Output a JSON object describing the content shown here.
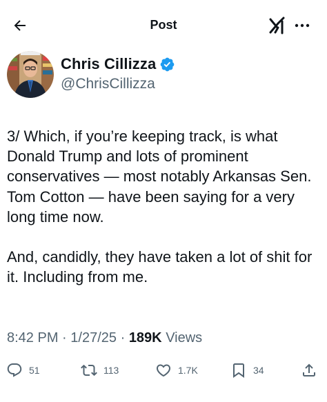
{
  "header": {
    "title": "Post",
    "back_icon": "arrow-left-icon",
    "grok_icon": "grok-icon",
    "more_icon": "more-horizontal-icon"
  },
  "author": {
    "name": "Chris Cillizza",
    "handle": "@ChrisCillizza",
    "verified": true,
    "verified_color": "#1d9bf0"
  },
  "tweet": {
    "paragraphs": [
      "3/ Which, if you’re keeping track, is what Donald Trump and lots of prominent conservatives — most notably Arkansas Sen. Tom Cotton — have been saying for a very long time now.",
      "And, candidly, they have taken a lot of shit for it. Including from me."
    ]
  },
  "meta": {
    "time": "8:42 PM",
    "separator": "·",
    "date": "1/27/25",
    "views_count": "189K",
    "views_label": "Views"
  },
  "actions": {
    "replies": "51",
    "reposts": "113",
    "likes": "1.7K",
    "bookmarks": "34"
  },
  "colors": {
    "text": "#0f1419",
    "secondary": "#536471",
    "accent": "#1d9bf0"
  }
}
